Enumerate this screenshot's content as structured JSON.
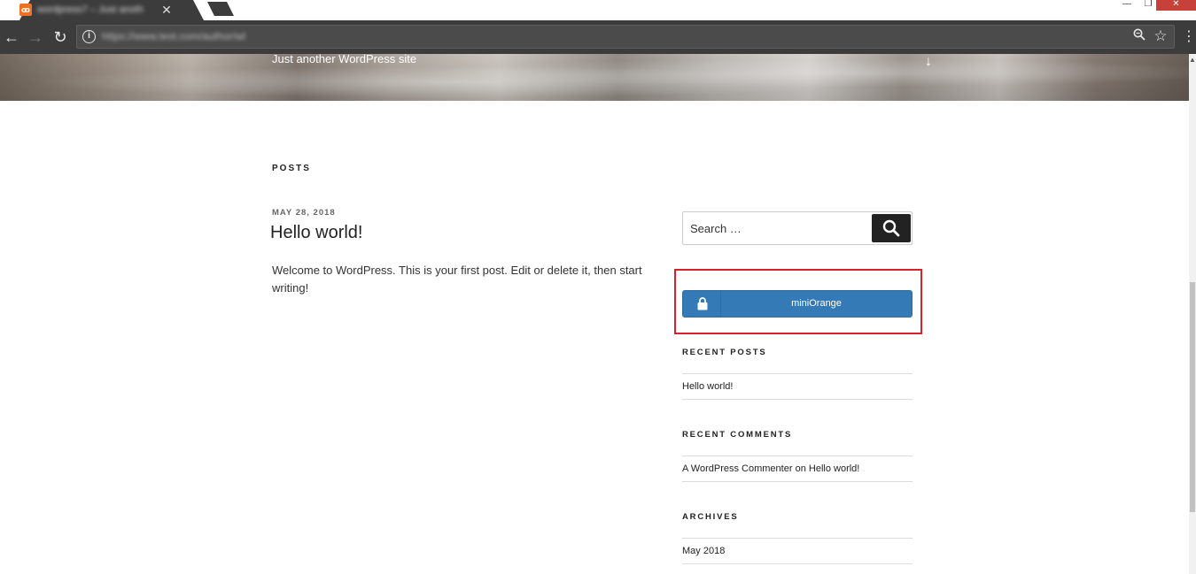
{
  "browser": {
    "tab_title": "wordpress7 – Just anoth…",
    "tab_favicon": "xampp-icon",
    "url": "https://www.test.com/author/wl",
    "window_controls": [
      "minimize-icon",
      "restore-icon",
      "close-icon"
    ],
    "icons": [
      "back-arrow-icon",
      "forward-arrow-icon",
      "reload-icon",
      "info-icon",
      "zoom-icon",
      "star-icon",
      "kebab-menu-icon"
    ]
  },
  "header": {
    "tagline": "Just another WordPress site",
    "scroll_icon": "arrow-down-icon"
  },
  "main": {
    "section_heading": "POSTS",
    "post": {
      "date": "MAY 28, 2018",
      "title": "Hello world!",
      "excerpt": "Welcome to WordPress. This is your first post. Edit or delete it, then start writing!"
    }
  },
  "sidebar": {
    "search": {
      "placeholder": "Search …",
      "icon": "search-icon"
    },
    "login_button": {
      "label": "miniOrange",
      "icon": "lock-icon",
      "color": "#337ab7"
    },
    "highlight_color": "#d9202b",
    "recent_posts": {
      "title": "RECENT POSTS",
      "items": [
        "Hello world!"
      ]
    },
    "recent_comments": {
      "title": "RECENT COMMENTS",
      "items": [
        {
          "author": "A WordPress Commenter",
          "connector": "on",
          "post": "Hello world!"
        }
      ]
    },
    "archives": {
      "title": "ARCHIVES",
      "items": [
        "May 2018"
      ]
    }
  }
}
